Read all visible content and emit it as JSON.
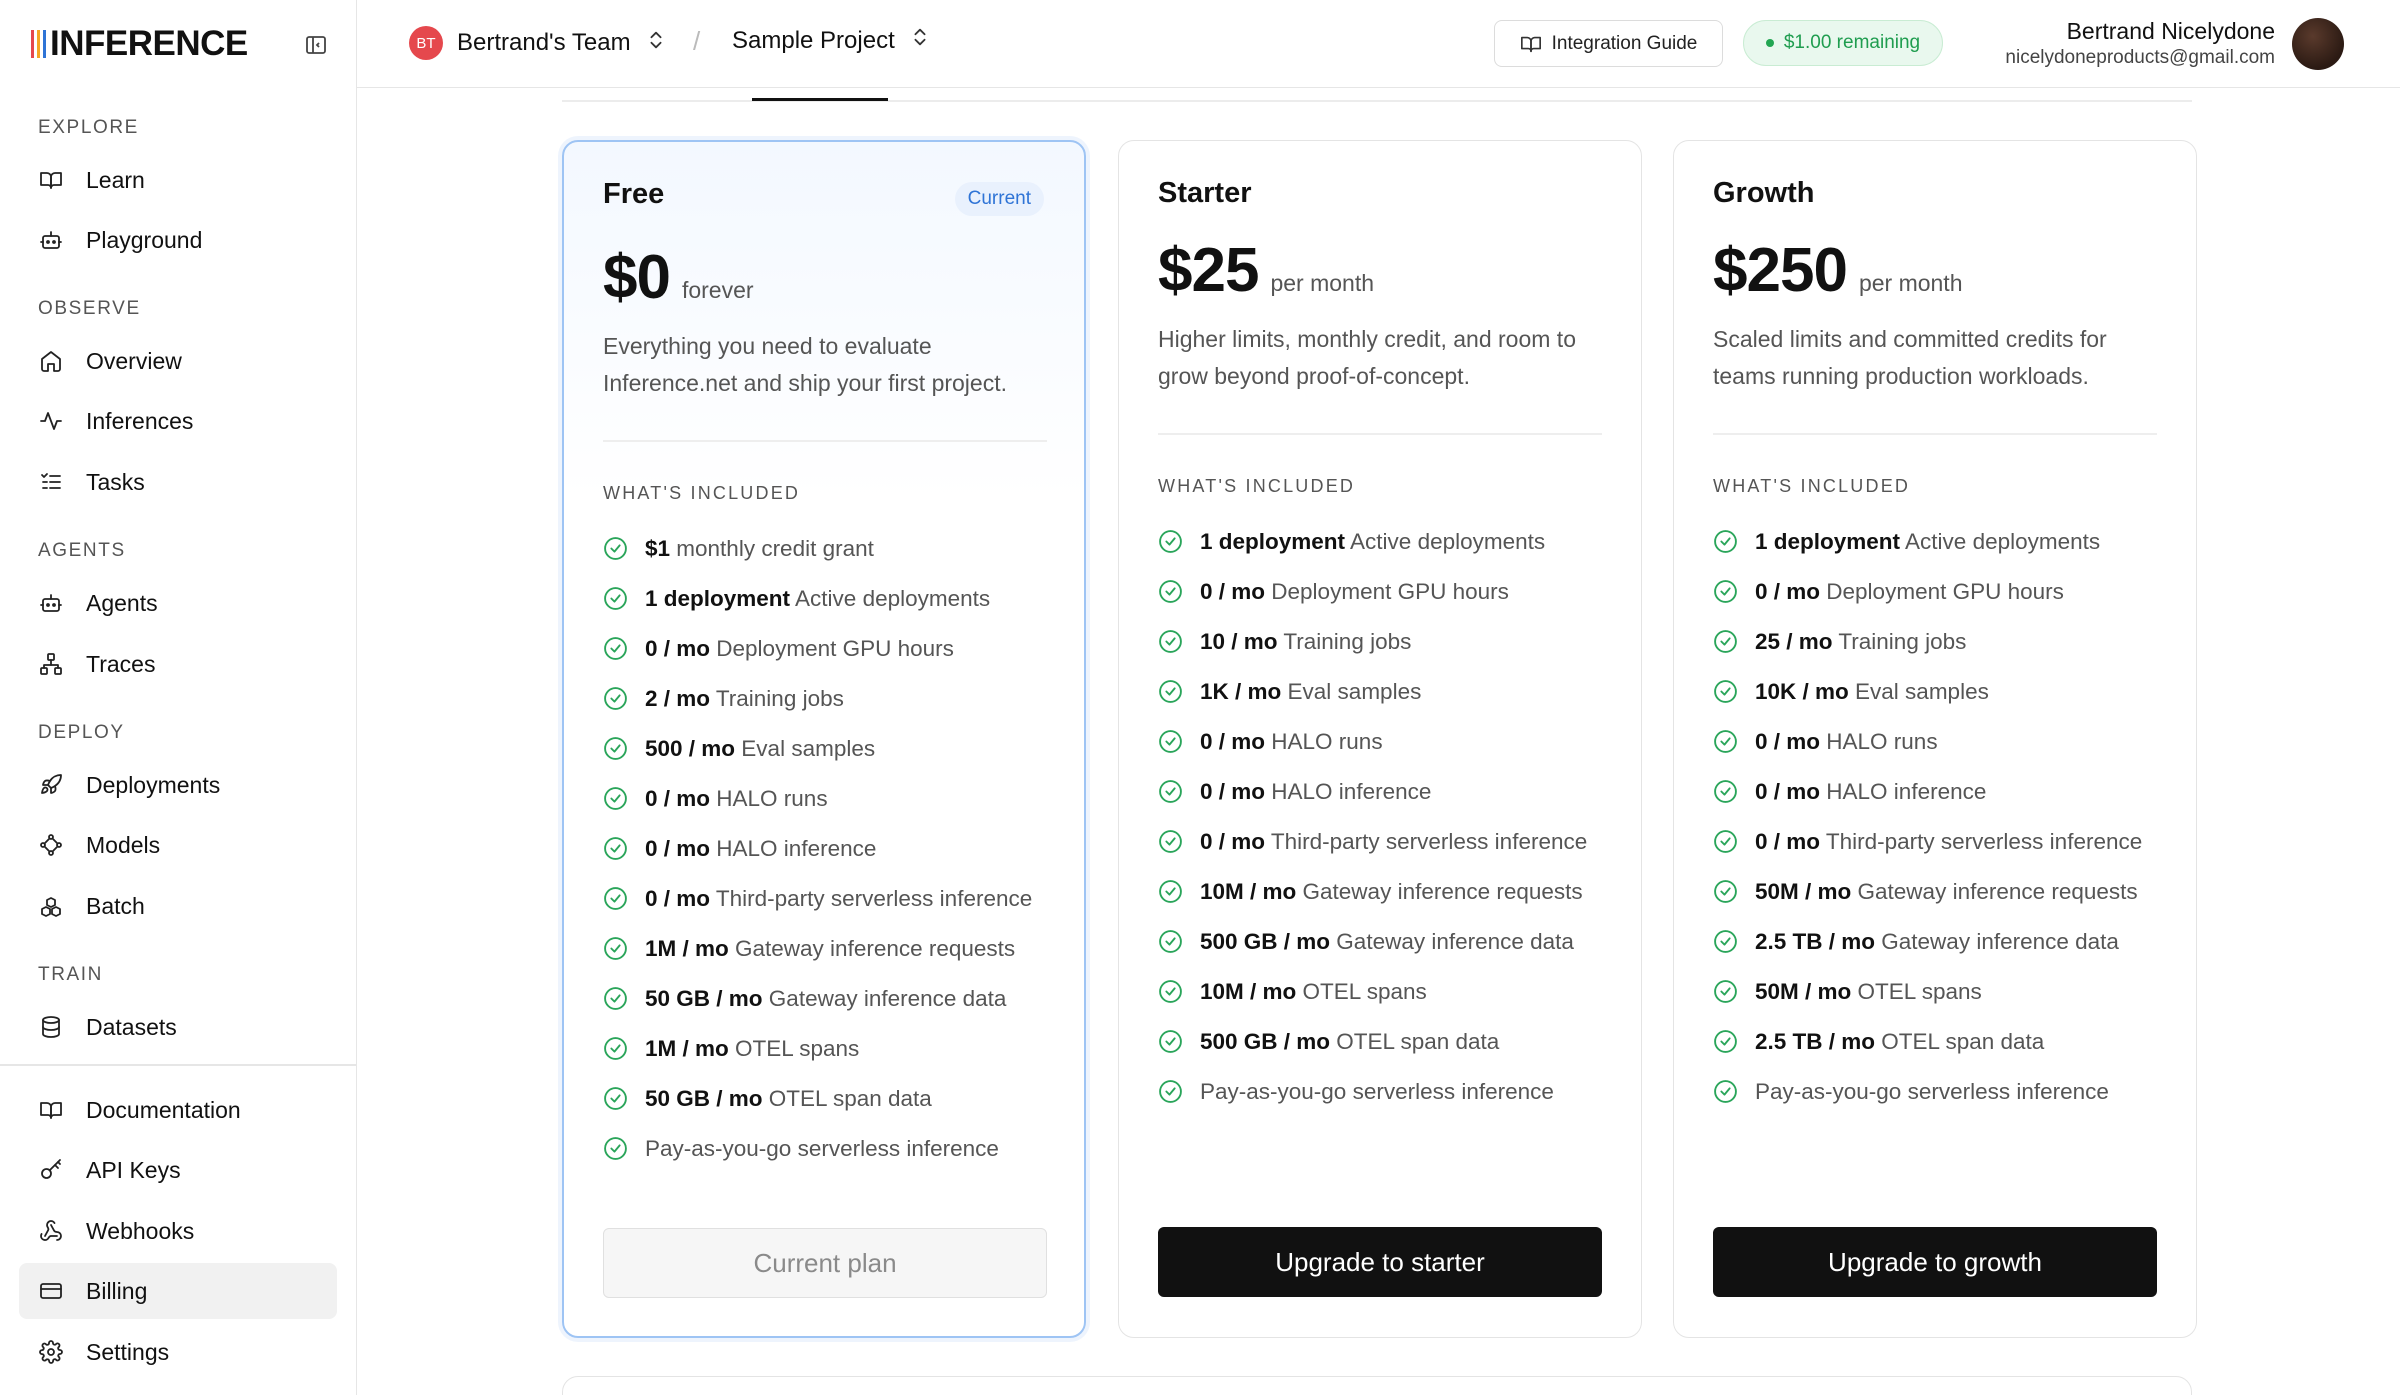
{
  "brand": {
    "name": "INFERENCE",
    "bar_colors": [
      "#e5484d",
      "#f5a623",
      "#2f74d6"
    ]
  },
  "sidebar": {
    "sections": [
      {
        "label": "EXPLORE",
        "items": [
          {
            "label": "Learn",
            "icon": "book-icon"
          },
          {
            "label": "Playground",
            "icon": "robot-icon"
          }
        ]
      },
      {
        "label": "OBSERVE",
        "items": [
          {
            "label": "Overview",
            "icon": "home-icon"
          },
          {
            "label": "Inferences",
            "icon": "activity-icon"
          },
          {
            "label": "Tasks",
            "icon": "list-icon"
          }
        ]
      },
      {
        "label": "AGENTS",
        "items": [
          {
            "label": "Agents",
            "icon": "robot-icon"
          },
          {
            "label": "Traces",
            "icon": "network-icon"
          }
        ]
      },
      {
        "label": "DEPLOY",
        "items": [
          {
            "label": "Deployments",
            "icon": "rocket-icon"
          },
          {
            "label": "Models",
            "icon": "nodes-icon"
          },
          {
            "label": "Batch",
            "icon": "boxes-icon"
          }
        ]
      },
      {
        "label": "TRAIN",
        "items": [
          {
            "label": "Datasets",
            "icon": "database-icon"
          }
        ]
      }
    ],
    "bottom_items": [
      {
        "label": "Documentation",
        "icon": "book-icon"
      },
      {
        "label": "API Keys",
        "icon": "key-icon"
      },
      {
        "label": "Webhooks",
        "icon": "webhook-icon"
      },
      {
        "label": "Billing",
        "icon": "card-icon",
        "active": true
      },
      {
        "label": "Settings",
        "icon": "gear-icon"
      }
    ]
  },
  "header": {
    "team_initials": "BT",
    "team_name": "Bertrand's Team",
    "separator": "/",
    "project_name": "Sample Project",
    "guide_label": "Integration Guide",
    "credit_label": "$1.00 remaining",
    "user_name": "Bertrand Nicelydone",
    "user_email": "nicelydoneproducts@gmail.com"
  },
  "plans": [
    {
      "name": "Free",
      "tag": "Current",
      "price": "$0",
      "period": "forever",
      "description": "Everything you need to evaluate Inference.net and ship your first project.",
      "included_label": "WHAT'S INCLUDED",
      "features": [
        {
          "value": "$1",
          "text": " monthly credit grant"
        },
        {
          "value": "1 deployment",
          "text": " Active deployments"
        },
        {
          "value": "0 / mo",
          "text": " Deployment GPU hours"
        },
        {
          "value": "2 / mo",
          "text": " Training jobs"
        },
        {
          "value": "500 / mo",
          "text": " Eval samples"
        },
        {
          "value": "0 / mo",
          "text": " HALO runs"
        },
        {
          "value": "0 / mo",
          "text": " HALO inference"
        },
        {
          "value": "0 / mo",
          "text": " Third-party serverless inference"
        },
        {
          "value": "1M / mo",
          "text": " Gateway inference requests"
        },
        {
          "value": "50 GB / mo",
          "text": " Gateway inference data"
        },
        {
          "value": "1M / mo",
          "text": " OTEL spans"
        },
        {
          "value": "50 GB / mo",
          "text": " OTEL span data"
        },
        {
          "value": "",
          "text": "Pay-as-you-go serverless inference"
        }
      ],
      "button": "Current plan"
    },
    {
      "name": "Starter",
      "tag": "",
      "price": "$25",
      "period": "per month",
      "description": "Higher limits, monthly credit, and room to grow beyond proof-of-concept.",
      "included_label": "WHAT'S INCLUDED",
      "features": [
        {
          "value": "1 deployment",
          "text": " Active deployments"
        },
        {
          "value": "0 / mo",
          "text": " Deployment GPU hours"
        },
        {
          "value": "10 / mo",
          "text": " Training jobs"
        },
        {
          "value": "1K / mo",
          "text": " Eval samples"
        },
        {
          "value": "0 / mo",
          "text": " HALO runs"
        },
        {
          "value": "0 / mo",
          "text": " HALO inference"
        },
        {
          "value": "0 / mo",
          "text": " Third-party serverless inference"
        },
        {
          "value": "10M / mo",
          "text": " Gateway inference requests"
        },
        {
          "value": "500 GB / mo",
          "text": " Gateway inference data"
        },
        {
          "value": "10M / mo",
          "text": " OTEL spans"
        },
        {
          "value": "500 GB / mo",
          "text": " OTEL span data"
        },
        {
          "value": "",
          "text": "Pay-as-you-go serverless inference"
        }
      ],
      "button": "Upgrade to starter"
    },
    {
      "name": "Growth",
      "tag": "",
      "price": "$250",
      "period": "per month",
      "description": "Scaled limits and committed credits for teams running production workloads.",
      "included_label": "WHAT'S INCLUDED",
      "features": [
        {
          "value": "1 deployment",
          "text": " Active deployments"
        },
        {
          "value": "0 / mo",
          "text": " Deployment GPU hours"
        },
        {
          "value": "25 / mo",
          "text": " Training jobs"
        },
        {
          "value": "10K / mo",
          "text": " Eval samples"
        },
        {
          "value": "0 / mo",
          "text": " HALO runs"
        },
        {
          "value": "0 / mo",
          "text": " HALO inference"
        },
        {
          "value": "0 / mo",
          "text": " Third-party serverless inference"
        },
        {
          "value": "50M / mo",
          "text": " Gateway inference requests"
        },
        {
          "value": "2.5 TB / mo",
          "text": " Gateway inference data"
        },
        {
          "value": "50M / mo",
          "text": " OTEL spans"
        },
        {
          "value": "2.5 TB / mo",
          "text": " OTEL span data"
        },
        {
          "value": "",
          "text": "Pay-as-you-go serverless inference"
        }
      ],
      "button": "Upgrade to growth"
    }
  ]
}
